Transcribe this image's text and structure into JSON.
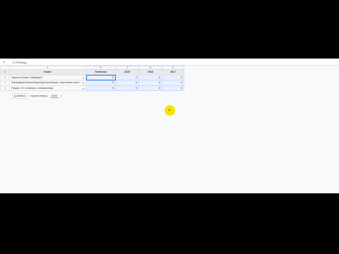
{
  "formula_bar": {
    "fx_label": "fx",
    "value": "=СТРОКА()"
  },
  "columns": {
    "letters": [
      "A",
      "B",
      "C",
      "D",
      "E"
    ]
  },
  "header_row": {
    "row_number": "1",
    "cells": [
      "Книги",
      "Тематика",
      "2015",
      "2016",
      "2017"
    ]
  },
  "rows": [
    {
      "row_number": "2",
      "book": "Окрытое Море. Мемуары?",
      "values": [
        "0",
        "0",
        "0",
        "0"
      ]
    },
    {
      "row_number": "3",
      "book": "Исследовательское/культурологическое, как помочь нам ?",
      "values": [
        "0",
        "0",
        "0",
        "0"
      ]
    },
    {
      "row_number": "4",
      "book": "Рыжие. От отчаяния к гениальному",
      "values": [
        "0",
        "0",
        "0",
        "0"
      ]
    }
  ],
  "add_rows": {
    "button_label": "Добавить",
    "middle_text": "строки внизу ( ",
    "count": "1000",
    "suffix": ")"
  },
  "cursor_color": "#f5e400"
}
